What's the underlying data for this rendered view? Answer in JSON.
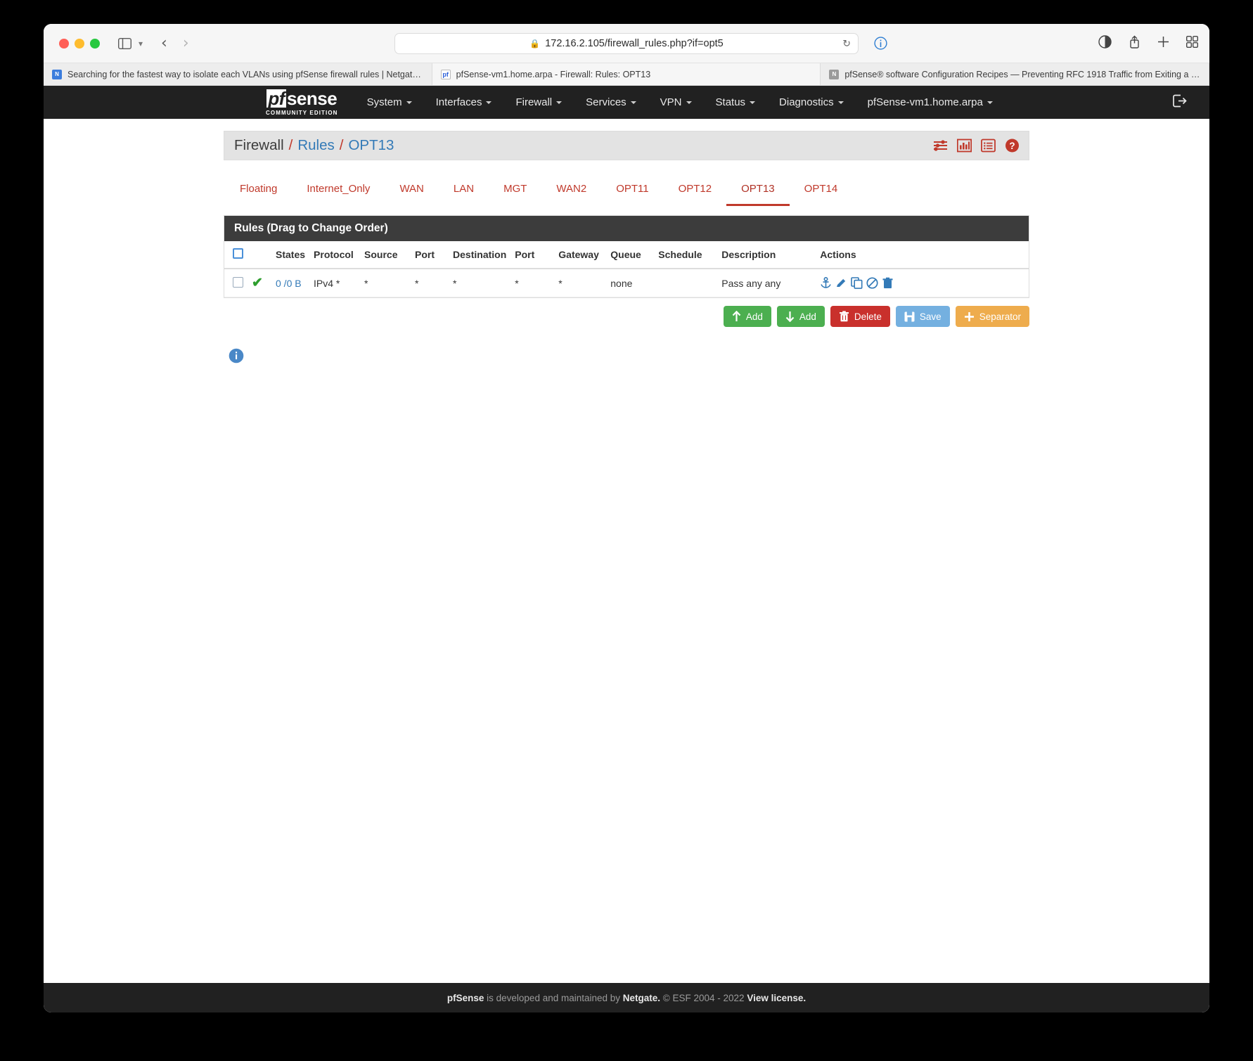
{
  "browser": {
    "url": "172.16.2.105/firewall_rules.php?if=opt5",
    "lock_icon": "lock-icon",
    "reload_icon": "reload-icon",
    "tabs": [
      {
        "title": "Searching for the fastest way to isolate each VLANs using pfSense firewall rules | Netgate For...",
        "favicon": "netgate-favicon",
        "active": false
      },
      {
        "title": "pfSense-vm1.home.arpa - Firewall: Rules: OPT13",
        "favicon": "pfsense-favicon",
        "active": true
      },
      {
        "title": "pfSense® software Configuration Recipes — Preventing RFC 1918 Traffic from Exiting a WAN I...",
        "favicon": "docs-favicon",
        "active": false
      }
    ]
  },
  "navbar": {
    "brand": "pfsense",
    "brand_pf": "pf",
    "brand_sense": "sense",
    "brand_sub": "COMMUNITY EDITION",
    "items": [
      {
        "label": "System",
        "caret": true
      },
      {
        "label": "Interfaces",
        "caret": true
      },
      {
        "label": "Firewall",
        "caret": true
      },
      {
        "label": "Services",
        "caret": true
      },
      {
        "label": "VPN",
        "caret": true
      },
      {
        "label": "Status",
        "caret": true
      },
      {
        "label": "Diagnostics",
        "caret": true
      },
      {
        "label": "pfSense-vm1.home.arpa",
        "caret": true
      }
    ],
    "logout_icon": "logout-icon"
  },
  "breadcrumb": {
    "root": "Firewall",
    "sep": "/",
    "level2": "Rules",
    "level3": "OPT13",
    "icons": [
      "sliders-icon",
      "bar-chart-icon",
      "list-icon",
      "help-icon"
    ]
  },
  "tabs": [
    {
      "label": "Floating",
      "active": false
    },
    {
      "label": "Internet_Only",
      "active": false
    },
    {
      "label": "WAN",
      "active": false
    },
    {
      "label": "LAN",
      "active": false
    },
    {
      "label": "MGT",
      "active": false
    },
    {
      "label": "WAN2",
      "active": false
    },
    {
      "label": "OPT11",
      "active": false
    },
    {
      "label": "OPT12",
      "active": false
    },
    {
      "label": "OPT13",
      "active": true
    },
    {
      "label": "OPT14",
      "active": false
    }
  ],
  "panel": {
    "title": "Rules (Drag to Change Order)",
    "columns": [
      "",
      "",
      "States",
      "Protocol",
      "Source",
      "Port",
      "Destination",
      "Port",
      "Gateway",
      "Queue",
      "Schedule",
      "Description",
      "Actions"
    ],
    "rows": [
      {
        "selected": false,
        "status_icon": "pass-check-icon",
        "states": "0 /0 B",
        "protocol": "IPv4 *",
        "source": "*",
        "source_port": "*",
        "destination": "*",
        "dest_port": "*",
        "gateway": "*",
        "queue": "none",
        "schedule": "",
        "description": "Pass any any",
        "actions": [
          "anchor-icon",
          "edit-icon",
          "copy-icon",
          "disable-icon",
          "delete-icon"
        ]
      }
    ]
  },
  "buttons": [
    {
      "label": "Add",
      "icon": "arrow-up-icon",
      "style": "green"
    },
    {
      "label": "Add",
      "icon": "arrow-down-icon",
      "style": "green"
    },
    {
      "label": "Delete",
      "icon": "trash-icon",
      "style": "red"
    },
    {
      "label": "Save",
      "icon": "save-icon",
      "style": "blue"
    },
    {
      "label": "Separator",
      "icon": "plus-icon",
      "style": "orange"
    }
  ],
  "info": {
    "icon": "info-icon"
  },
  "footer": {
    "brand": "pfSense",
    "text1": " is developed and maintained by ",
    "company": "Netgate.",
    "copyright": " © ESF 2004 - 2022 ",
    "license": "View license."
  },
  "colors": {
    "accent_red": "#c0392b",
    "link_blue": "#337ab7",
    "nav_dark": "#212121",
    "panel_head": "#3c3c3c"
  }
}
